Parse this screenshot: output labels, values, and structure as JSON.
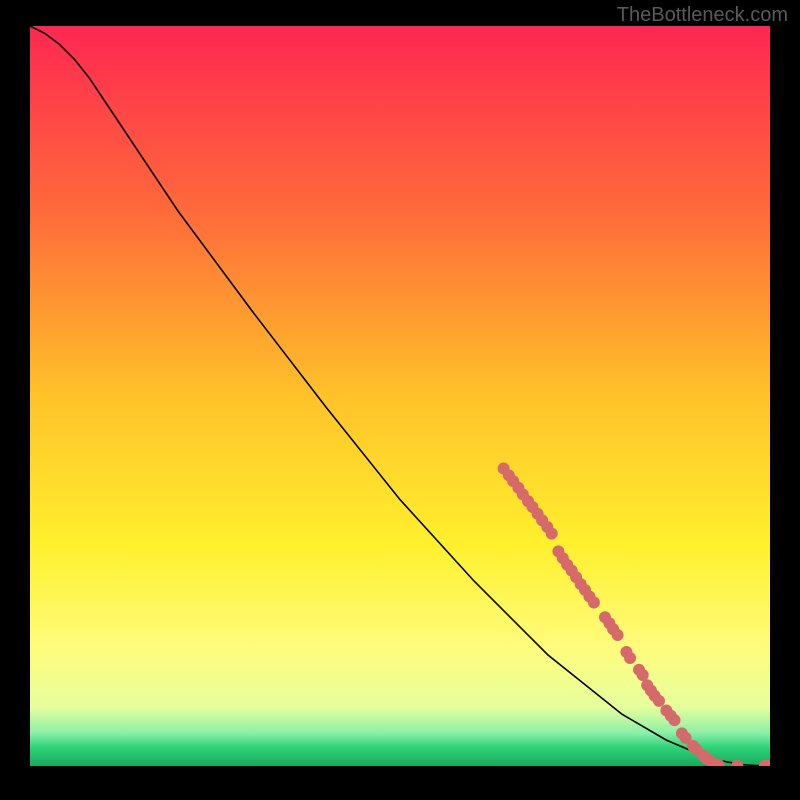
{
  "watermark": "TheBottleneck.com",
  "chart_data": {
    "type": "line",
    "title": "",
    "xlabel": "",
    "ylabel": "",
    "xlim": [
      0,
      100
    ],
    "ylim": [
      0,
      100
    ],
    "gradient_stops": [
      {
        "offset": 0.0,
        "color": "#ff2752"
      },
      {
        "offset": 0.25,
        "color": "#ff6a3a"
      },
      {
        "offset": 0.5,
        "color": "#ffc229"
      },
      {
        "offset": 0.7,
        "color": "#fff02d"
      },
      {
        "offset": 0.84,
        "color": "#fffc7d"
      },
      {
        "offset": 0.92,
        "color": "#e6ff9c"
      },
      {
        "offset": 0.955,
        "color": "#8cf0a8"
      },
      {
        "offset": 0.975,
        "color": "#2ed37a"
      },
      {
        "offset": 1.0,
        "color": "#1aa85e"
      }
    ],
    "series": [
      {
        "name": "bottleneck-curve",
        "color": "#000000",
        "x": [
          0,
          2,
          4,
          6,
          8,
          10,
          14,
          20,
          30,
          40,
          50,
          60,
          70,
          80,
          86,
          90,
          93,
          96,
          98,
          100
        ],
        "y": [
          100,
          99,
          97.5,
          95.5,
          93,
          90,
          84,
          75,
          61.5,
          48.5,
          36,
          25,
          15,
          7,
          3.5,
          1.8,
          0.8,
          0.2,
          0.05,
          0.05
        ]
      }
    ],
    "data_points": {
      "name": "highlighted-points",
      "color": "#d66a6a",
      "radius": 6,
      "points": [
        {
          "x": 64.0,
          "y": 40.2
        },
        {
          "x": 64.7,
          "y": 39.3
        },
        {
          "x": 65.3,
          "y": 38.5
        },
        {
          "x": 66.0,
          "y": 37.6
        },
        {
          "x": 66.6,
          "y": 36.7
        },
        {
          "x": 67.3,
          "y": 35.8
        },
        {
          "x": 67.9,
          "y": 35.0
        },
        {
          "x": 68.6,
          "y": 34.1
        },
        {
          "x": 69.2,
          "y": 33.2
        },
        {
          "x": 69.9,
          "y": 32.3
        },
        {
          "x": 70.5,
          "y": 31.4
        },
        {
          "x": 71.4,
          "y": 29.0
        },
        {
          "x": 72.0,
          "y": 28.1
        },
        {
          "x": 72.6,
          "y": 27.2
        },
        {
          "x": 73.2,
          "y": 26.4
        },
        {
          "x": 73.8,
          "y": 25.5
        },
        {
          "x": 74.4,
          "y": 24.6
        },
        {
          "x": 75.0,
          "y": 23.8
        },
        {
          "x": 75.6,
          "y": 22.9
        },
        {
          "x": 76.2,
          "y": 22.1
        },
        {
          "x": 77.7,
          "y": 20.1
        },
        {
          "x": 78.3,
          "y": 19.3
        },
        {
          "x": 78.8,
          "y": 18.5
        },
        {
          "x": 79.4,
          "y": 17.7
        },
        {
          "x": 80.6,
          "y": 15.4
        },
        {
          "x": 81.1,
          "y": 14.6
        },
        {
          "x": 82.3,
          "y": 13.0
        },
        {
          "x": 82.8,
          "y": 12.3
        },
        {
          "x": 83.4,
          "y": 10.9
        },
        {
          "x": 83.9,
          "y": 10.2
        },
        {
          "x": 84.4,
          "y": 9.5
        },
        {
          "x": 85.0,
          "y": 8.8
        },
        {
          "x": 86.0,
          "y": 7.5
        },
        {
          "x": 86.6,
          "y": 6.8
        },
        {
          "x": 87.1,
          "y": 6.2
        },
        {
          "x": 88.1,
          "y": 4.4
        },
        {
          "x": 88.6,
          "y": 3.8
        },
        {
          "x": 89.6,
          "y": 2.7
        },
        {
          "x": 90.0,
          "y": 2.3
        },
        {
          "x": 91.0,
          "y": 1.4
        },
        {
          "x": 91.4,
          "y": 1.0
        },
        {
          "x": 91.9,
          "y": 0.7
        },
        {
          "x": 92.3,
          "y": 0.4
        },
        {
          "x": 92.7,
          "y": 0.2
        },
        {
          "x": 93.1,
          "y": 0.1
        },
        {
          "x": 95.6,
          "y": 0.05
        },
        {
          "x": 99.3,
          "y": 0.05
        },
        {
          "x": 100.0,
          "y": 0.05
        }
      ]
    }
  }
}
